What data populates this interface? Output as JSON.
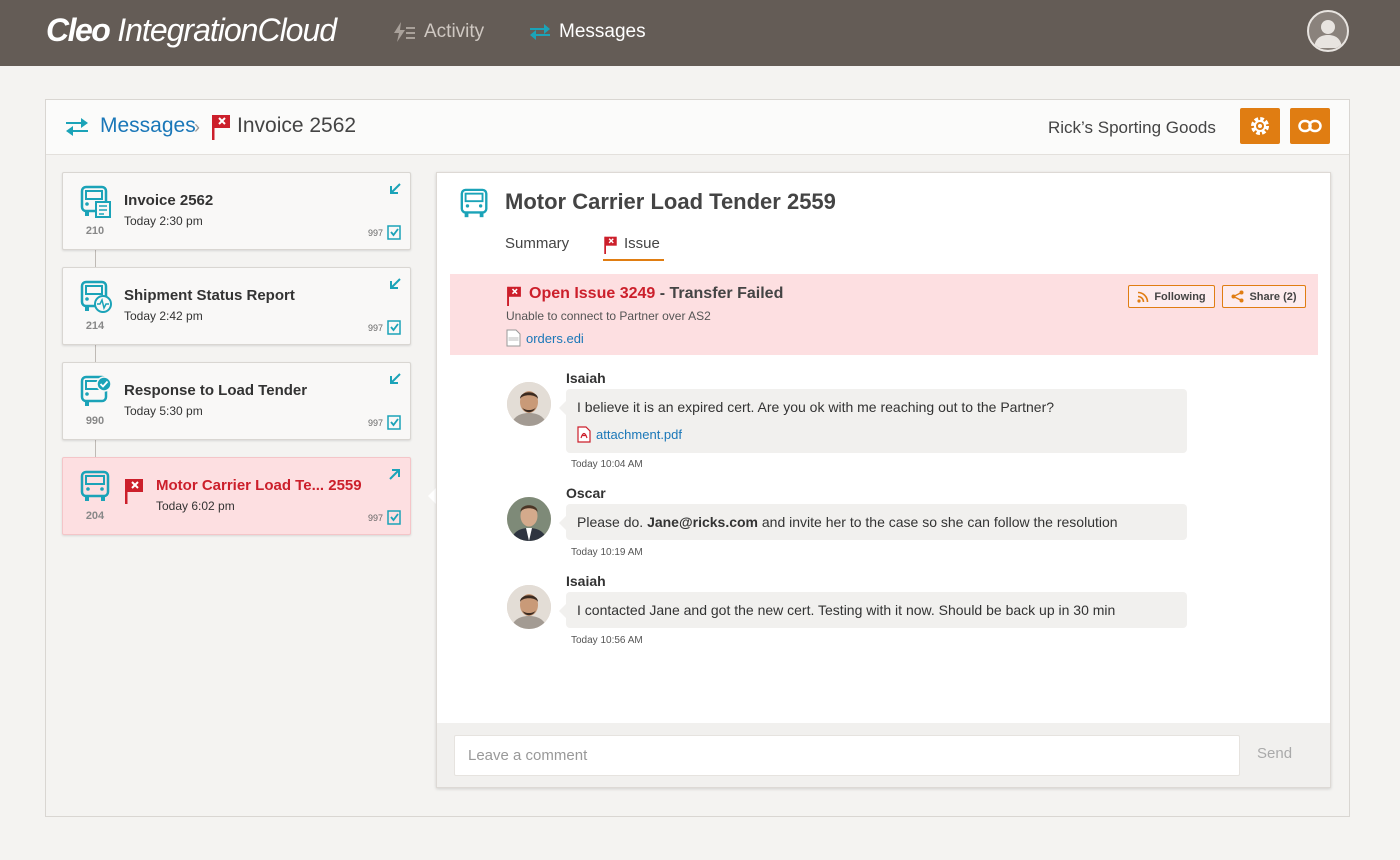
{
  "app": {
    "logo_bold": "Cleo",
    "logo_rest": " IntegrationCloud"
  },
  "nav": {
    "activity": "Activity",
    "messages": "Messages"
  },
  "breadcrumb": {
    "root": "Messages",
    "current": "Invoice 2562"
  },
  "header": {
    "company": "Rick’s Sporting Goods"
  },
  "messages": [
    {
      "title": "Invoice 2562",
      "time": "Today 2:30 pm",
      "count": "210",
      "ack": "997",
      "icon": "truck-invoice-icon",
      "direction": "inbound"
    },
    {
      "title": "Shipment Status Report",
      "time": "Today 2:42 pm",
      "count": "214",
      "ack": "997",
      "icon": "truck-status-icon",
      "direction": "inbound"
    },
    {
      "title": "Response to Load Tender",
      "time": "Today 5:30 pm",
      "count": "990",
      "ack": "997",
      "icon": "truck-response-icon",
      "direction": "inbound"
    },
    {
      "title": "Motor Carrier Load Te... 2559",
      "time": "Today 6:02 pm",
      "count": "204",
      "ack": "997",
      "icon": "truck-icon",
      "direction": "outbound",
      "flagged": true
    }
  ],
  "detail": {
    "title": "Motor Carrier Load Tender 2559",
    "tabs": {
      "summary": "Summary",
      "issue": "Issue"
    },
    "issue": {
      "title": "Open Issue 3249",
      "subtitle": " - Transfer Failed",
      "description": "Unable to connect to Partner over AS2",
      "file": "orders.edi",
      "following": "Following",
      "share": "Share (2)"
    },
    "comments": [
      {
        "author": "Isaiah",
        "text": "I believe it is an expired cert. Are you ok with me reaching out to the Partner?",
        "attachment": "attachment.pdf",
        "stamp": "Today  10:04 AM"
      },
      {
        "author": "Oscar",
        "text_before": "Please do. ",
        "text_bold": "Jane@ricks.com",
        "text_after": " and invite her to the case so she can follow the resolution",
        "stamp": "Today  10:19 AM"
      },
      {
        "author": "Isaiah",
        "text": "I contacted Jane and got the new cert. Testing with it now. Should be back up in 30 min",
        "stamp": "Today  10:56 AM"
      }
    ],
    "composer": {
      "placeholder": "Leave a comment",
      "send": "Send"
    }
  },
  "colors": {
    "topbar": "#645c56",
    "accent": "#e07d12",
    "teal": "#1ba3b8",
    "link": "#1a77b8",
    "error": "#cc1f2b",
    "error_bg": "#fddfe1"
  }
}
